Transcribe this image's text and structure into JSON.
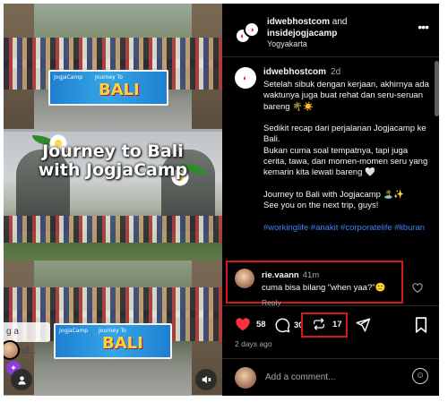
{
  "post": {
    "authors": [
      "idwebhostcom",
      "insidejogjacamp"
    ],
    "authors_joiner": "and",
    "location": "Yogyakarta",
    "more_icon": "more-horizontal-icon"
  },
  "media": {
    "overlay_title": "Journey to Bali\nwith JogjaCamp",
    "banner_text": "BALI",
    "banner_sub": "Journey To",
    "banner_logo": "JogjaCamp",
    "tag_placeholder": "g a friend...",
    "mute_icon": "speaker-muted-icon",
    "tag_icon": "user-tag-icon"
  },
  "caption": {
    "username": "idwebhostcom",
    "time": "2d",
    "body": "Setelah sibuk dengan kerjaan, akhirnya ada waktunya juga buat rehat dan seru-seruan bareng 🌴☀️\n\nSedikit recap dari perjalanan Jogjacamp ke Bali.\nBukan cuma soal tempatnya, tapi juga cerita, tawa, dan momen-momen seru yang kemarin kita lewati bareng 🤍\n\nJourney to Bali with Jogjacamp 🏝️✨\nSee you on the next trip, guys!\n\n",
    "hashtags": "#workinglife #anakit #corporatelife #liburan"
  },
  "comment": {
    "username": "rie.vaann",
    "time": "41m",
    "text": "cuma bisa bilang \"when yaa?\"🙂",
    "reply_label": "Reply"
  },
  "actions": {
    "likes": "58",
    "comments": "30",
    "reposts": "17",
    "time_ago": "2 days ago",
    "like_color": "#ff3040"
  },
  "add_comment": {
    "placeholder": "Add a comment..."
  }
}
